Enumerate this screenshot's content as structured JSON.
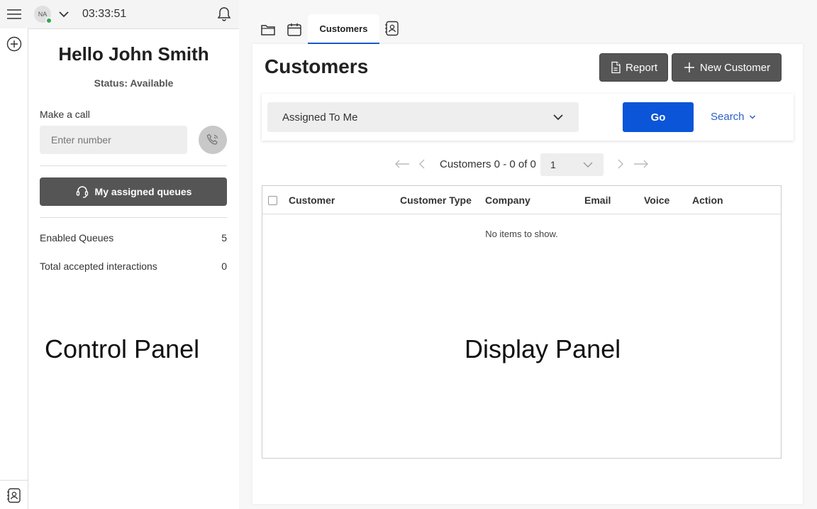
{
  "topbar": {
    "avatar_initials": "NA",
    "clock": "03:33:51",
    "presence_color": "#2fa84f"
  },
  "control": {
    "greeting": "Hello John Smith",
    "status": "Status: Available",
    "make_call_label": "Make a call",
    "number_placeholder": "Enter number",
    "queues_button": "My assigned queues",
    "stats": [
      {
        "label": "Enabled Queues",
        "value": "5"
      },
      {
        "label": "Total accepted interactions",
        "value": "0"
      }
    ],
    "panel_label": "Control Panel"
  },
  "tabs": {
    "active_label": "Customers"
  },
  "display": {
    "title": "Customers",
    "report_button": "Report",
    "new_customer_button": "New Customer",
    "filter_value": "Assigned To Me",
    "go_button": "Go",
    "search_link": "Search",
    "pager_label": "Customers 0 - 0 of 0",
    "page_value": "1",
    "columns": [
      "Customer",
      "Customer Type",
      "Company",
      "Email",
      "Voice",
      "Action"
    ],
    "empty_text": "No items to show.",
    "panel_label": "Display Panel",
    "accent_color": "#0a55d8"
  }
}
